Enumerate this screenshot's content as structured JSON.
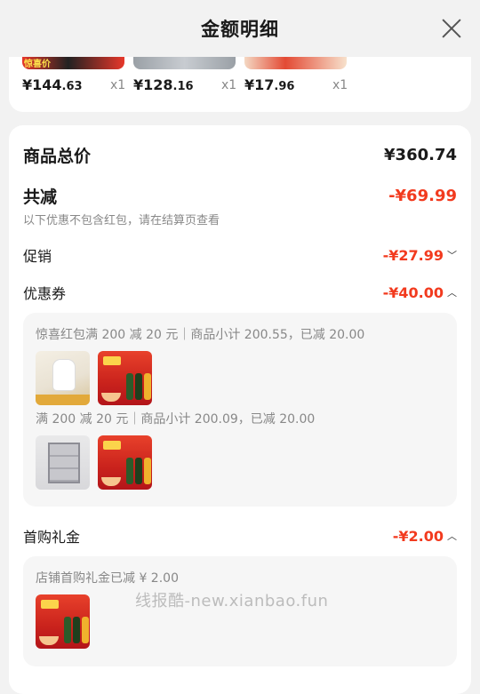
{
  "header": {
    "title": "金额明细"
  },
  "top_items": [
    {
      "price_int": "¥144",
      "price_dec": ".63",
      "qty": "x1",
      "banner": "惊喜价"
    },
    {
      "price_int": "¥128",
      "price_dec": ".16",
      "qty": "x1"
    },
    {
      "price_int": "¥17",
      "price_dec": ".96",
      "qty": "x1"
    }
  ],
  "summary": {
    "total_label": "商品总价",
    "total_value": "¥360.74",
    "discount_label": "共减",
    "discount_value": "-¥69.99",
    "discount_note": "以下优惠不包含红包，请在结算页查看"
  },
  "promo": {
    "label": "促销",
    "value": "-¥27.99"
  },
  "coupon": {
    "label": "优惠券",
    "value": "-¥40.00",
    "line1": "惊喜红包满 200 减 20 元｜商品小计 200.55，已减 20.00",
    "line2": "满 200 减 20 元｜商品小计 200.09，已减 20.00"
  },
  "first_gift": {
    "label": "首购礼金",
    "value": "-¥2.00",
    "line": "店铺首购礼金已减 ¥ 2.00"
  },
  "watermark": "线报酷-new.xianbao.fun",
  "colors": {
    "accent_red": "#f23a1e",
    "page_bg": "#f2f2f2"
  }
}
